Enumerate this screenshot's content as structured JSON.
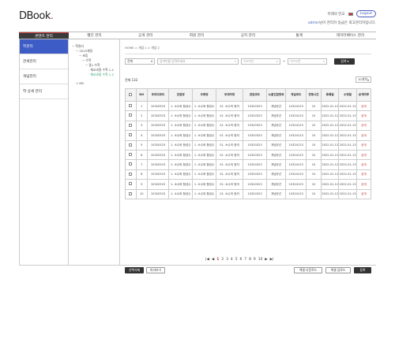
{
  "header": {
    "logo_main": "DBook",
    "logo_dot": ".",
    "lang_label": "미래의 언교",
    "logout_label": "Logout",
    "welcome_user": "admin",
    "welcome_text": "님이 관리자 등급은 최고관리자입니다."
  },
  "gnb": [
    "콘텐츠 관리",
    "웹진 관리",
    "공개 관리",
    "회원 관리",
    "공지 관리",
    "통계",
    "데이터베이스 관리"
  ],
  "lnb": [
    "학관리",
    "관세관리",
    "개념관리",
    "학 상세 관리"
  ],
  "tree": {
    "root": "학관리",
    "nodes": [
      "2015개정",
      "초등",
      "수학",
      "중1 수학",
      "체교과정 수학 1-1",
      "체교과정 수학 1-2"
    ],
    "extra": "KN"
  },
  "breadcrumb": "HOME > 개념 1 > 개념 2",
  "search": {
    "scope": "전체",
    "keyword_placeholder": "검색어를 입력하세요",
    "date_from_placeholder": "YYYY년",
    "range_sep": "~",
    "date_to_placeholder": "YYYY년",
    "submit_label": "검색"
  },
  "list": {
    "total_label": "전체 132",
    "rows_per_page": "10개씩",
    "headers": [
      "",
      "NO",
      "우리미코드",
      "단원명",
      "주제명",
      "무대의명",
      "관련코드",
      "노출인원정보",
      "개념코드",
      "전체시간",
      "등록일",
      "수정일",
      "공개여부"
    ],
    "rows": [
      [
        "",
        "1",
        "10320323",
        "1. 소수와 합성수",
        "1. 소수와 합성수",
        "01. 소수의 정의",
        "10320323",
        "개념우선",
        "10324123",
        "10",
        "2022-01-12",
        "2022-01-13",
        "공개"
      ],
      [
        "",
        "2",
        "10320323",
        "1. 소수와 합성수",
        "1. 소수와 합성수",
        "01. 소수의 정의",
        "10320323",
        "개념우선",
        "10324123",
        "10",
        "2022-01-12",
        "2022-01-13",
        "공개"
      ],
      [
        "",
        "3",
        "10320323",
        "1. 소수와 합성수",
        "1. 소수와 합성수",
        "01. 소수의 정의",
        "10320323",
        "개념우선",
        "10324123",
        "10",
        "2022-01-12",
        "2022-01-13",
        "공개"
      ],
      [
        "",
        "4",
        "10320323",
        "1. 소수와 합성수",
        "1. 소수와 합성수",
        "01. 소수의 정의",
        "10320323",
        "개념우선",
        "10324123",
        "10",
        "2022-01-12",
        "2022-01-13",
        "공개"
      ],
      [
        "",
        "5",
        "10320323",
        "1. 소수와 합성수",
        "1. 소수와 합성수",
        "01. 소수의 정의",
        "10320323",
        "개념우선",
        "10324123",
        "10",
        "2022-01-12",
        "2022-01-13",
        "공개"
      ],
      [
        "",
        "6",
        "10320323",
        "1. 소수와 합성수",
        "1. 소수와 합성수",
        "01. 소수의 정의",
        "10320323",
        "개념우선",
        "10324123",
        "10",
        "2022-01-12",
        "2022-01-13",
        "공개"
      ],
      [
        "",
        "7",
        "10320323",
        "1. 소수와 합성수",
        "1. 소수와 합성수",
        "01. 소수의 정의",
        "10320323",
        "개념우선",
        "10324123",
        "10",
        "2022-01-12",
        "2022-01-13",
        "공개"
      ],
      [
        "",
        "8",
        "10320323",
        "1. 소수와 합성수",
        "1. 소수와 합성수",
        "01. 소수의 정의",
        "10320323",
        "개념우선",
        "10324123",
        "10",
        "2022-01-12",
        "2022-01-13",
        "공개"
      ],
      [
        "",
        "9",
        "10320323",
        "1. 소수와 합성수",
        "1. 소수와 합성수",
        "01. 소수의 정의",
        "10320323",
        "개념우선",
        "10324123",
        "10",
        "2022-01-12",
        "2022-01-13",
        "공개"
      ],
      [
        "",
        "10",
        "10320323",
        "1. 소수와 합성수",
        "1. 소수와 합성수",
        "01. 소수의 정의",
        "10320323",
        "개념우선",
        "10324123",
        "10",
        "2022-01-12",
        "2022-01-13",
        "공개"
      ]
    ]
  },
  "pager": {
    "first": "|◀",
    "prev": "◀",
    "pages": [
      "1",
      "2",
      "3",
      "4",
      "5",
      "6",
      "7",
      "8",
      "9",
      "10"
    ],
    "current": "1",
    "next": "▶",
    "last": "▶|"
  },
  "actions": {
    "select_delete": "선택삭제",
    "bulk_select": "미리보기",
    "excel_download": "엑셀 다운로드",
    "excel_upload": "엑셀 업로드",
    "register": "등록"
  },
  "colors": {
    "accent": "#3d5cc6",
    "brand_red": "#c23636",
    "dark": "#333333"
  }
}
